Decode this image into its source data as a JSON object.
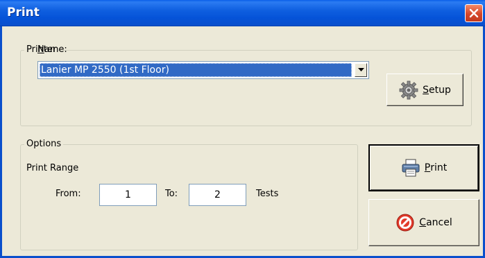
{
  "window": {
    "title": "Print"
  },
  "printer_group": {
    "legend": "Printer",
    "name_label_first": "N",
    "name_label_rest": "ame:",
    "selected_printer": "Lanier MP 2550 (1st Floor)"
  },
  "setup_button": {
    "mnemonic": "S",
    "rest": "etup",
    "icon": "gear-icon"
  },
  "options_group": {
    "legend": "Options",
    "print_range_label": "Print Range",
    "from_label": "From:",
    "from_value": "1",
    "to_label": "To:",
    "to_value": "2",
    "units_label": "Tests"
  },
  "print_button": {
    "mnemonic": "P",
    "rest": "rint",
    "icon": "printer-icon"
  },
  "cancel_button": {
    "mnemonic": "C",
    "rest": "ancel",
    "icon": "cancel-icon"
  }
}
